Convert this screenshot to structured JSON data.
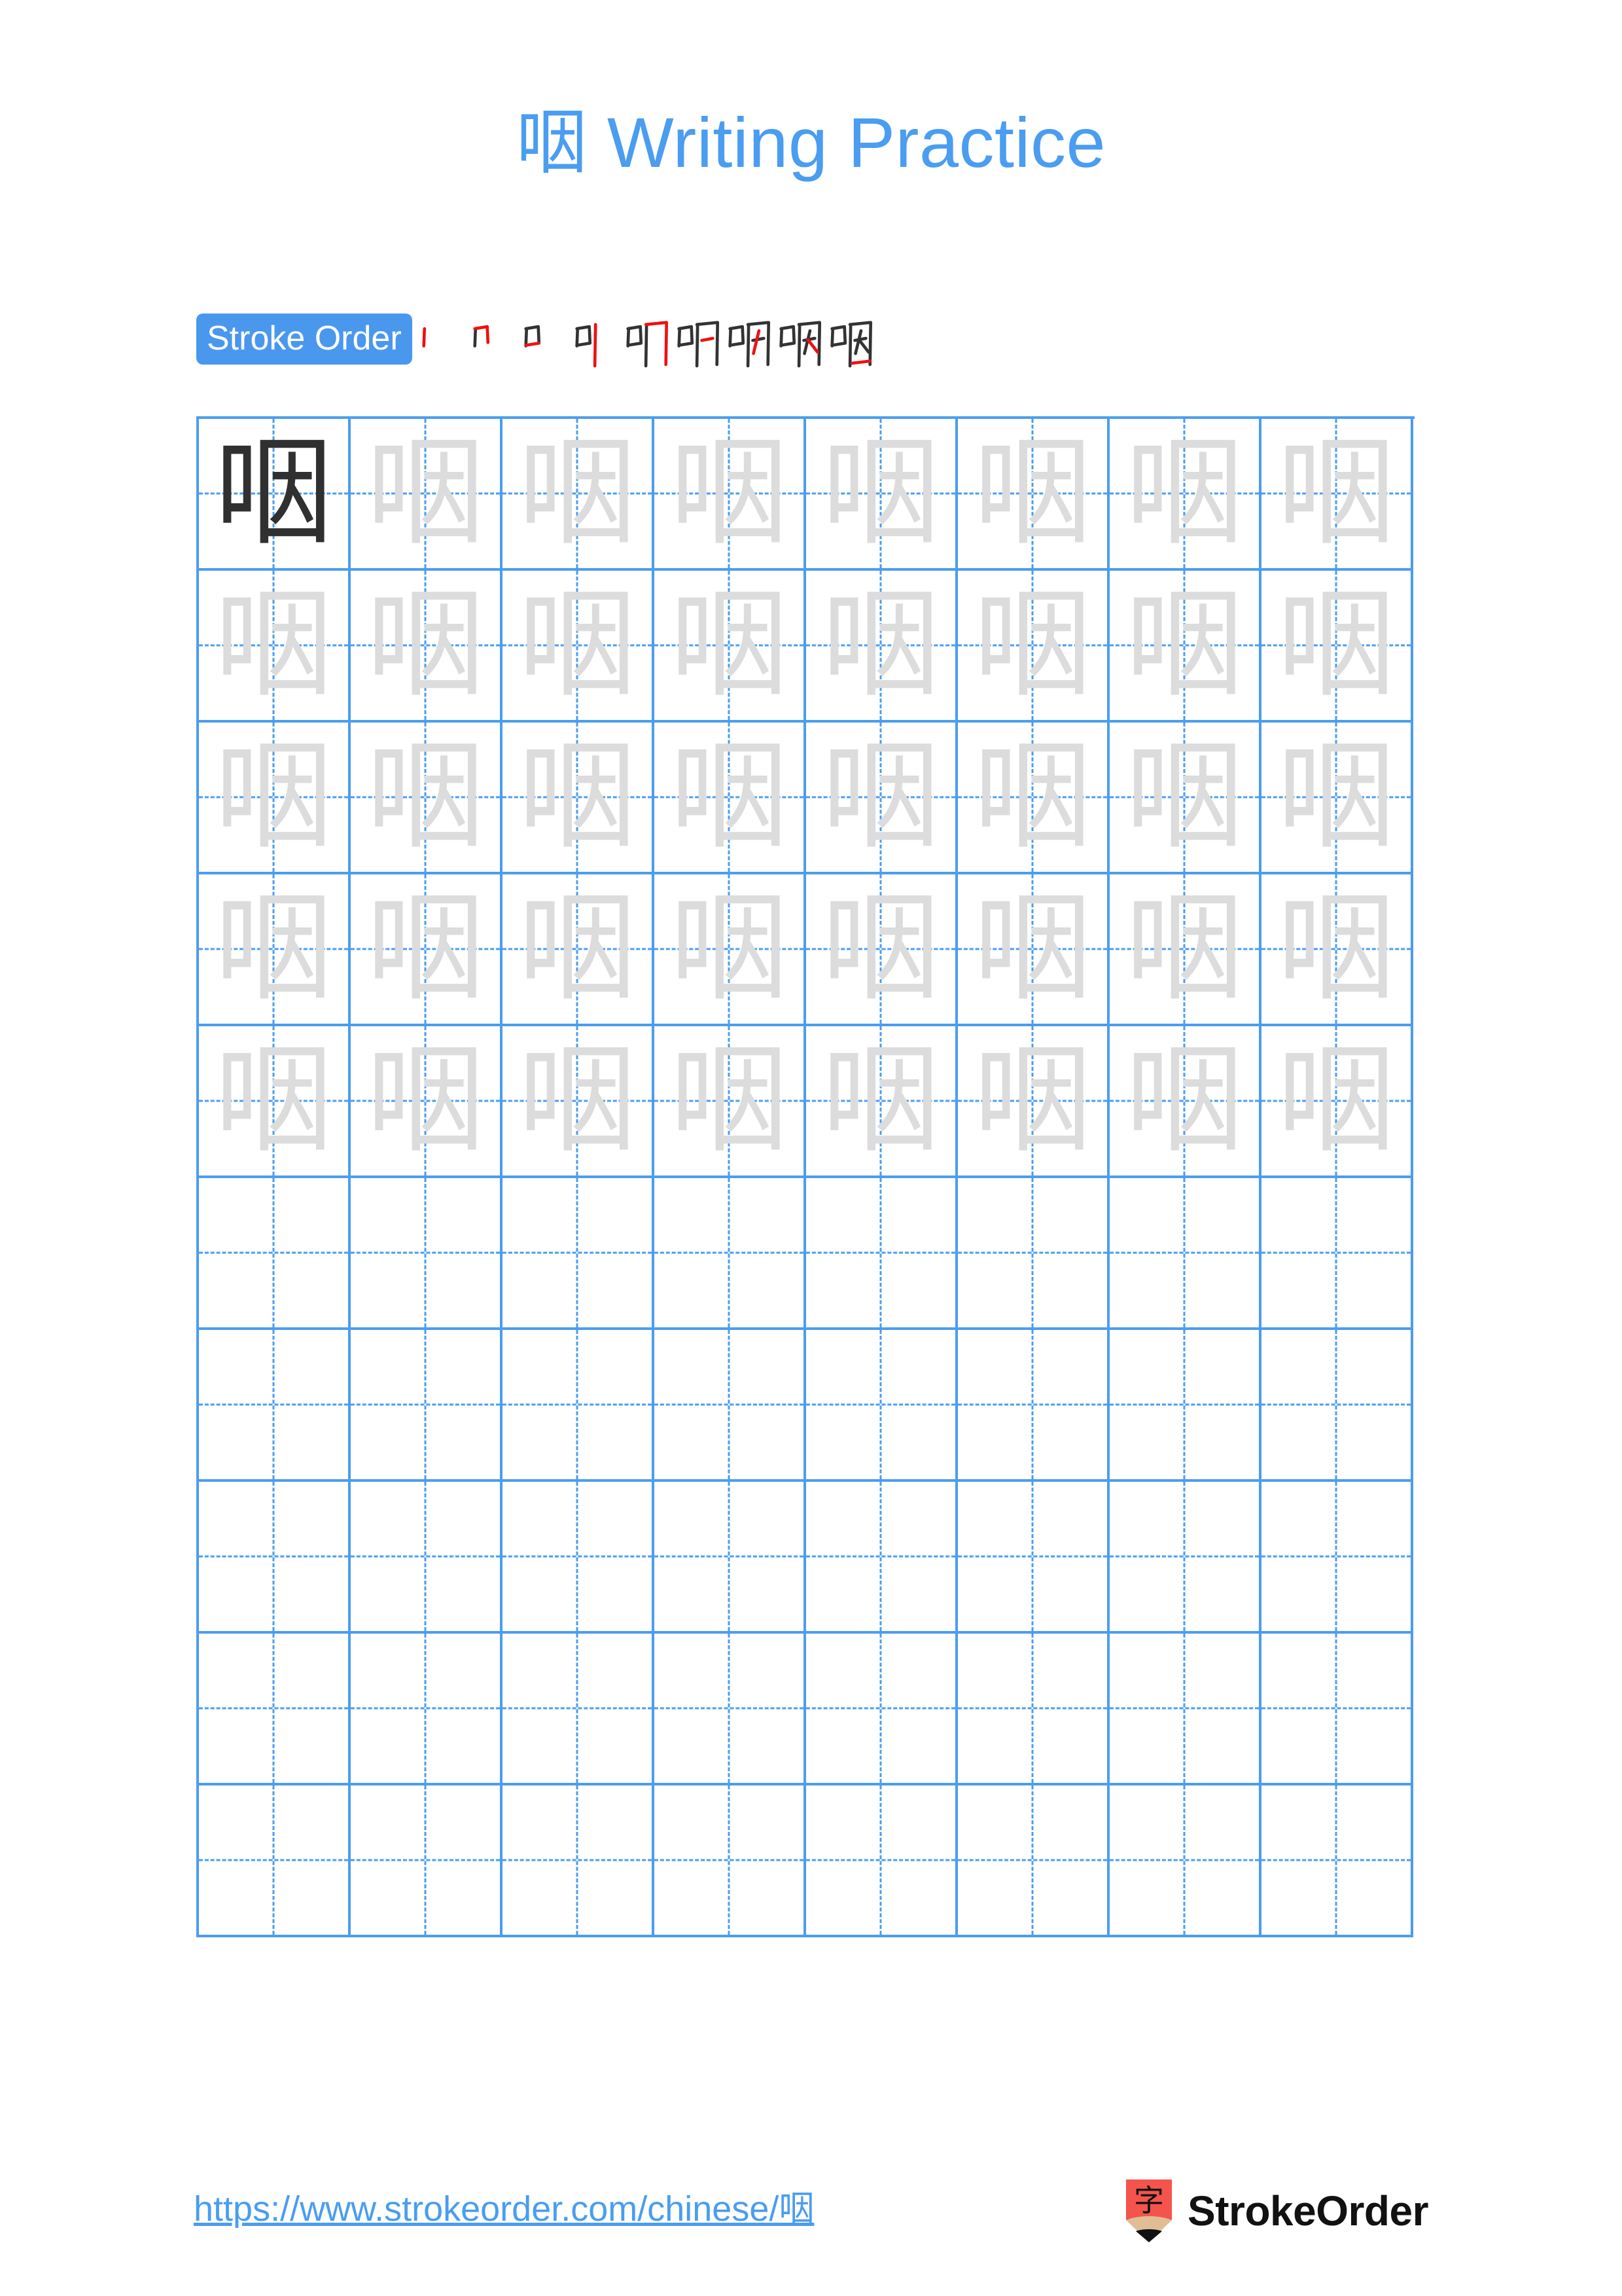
{
  "page": {
    "character": "咽",
    "title": "咽 Writing Practice",
    "title_suffix": "Writing Practice",
    "background_color": "#ffffff",
    "accent_color": "#4a9df0",
    "badge_color": "#4a97ee",
    "solid_char_color": "#303030",
    "trace_char_color": "#dcdcdc",
    "stroke_highlight_color": "#ee1111",
    "stroke_ink_color": "#333333"
  },
  "stroke_order": {
    "badge_label": "Stroke Order",
    "total_strokes": 9,
    "steps": [
      {
        "index": 1,
        "label": "丨",
        "cumulative": "丨"
      },
      {
        "index": 2,
        "label": "冂",
        "cumulative": "冂"
      },
      {
        "index": 3,
        "label": "口",
        "cumulative": "口"
      },
      {
        "index": 4,
        "label": "叫",
        "cumulative": "口丨"
      },
      {
        "index": 5,
        "label": "叮",
        "cumulative": "口冂"
      },
      {
        "index": 6,
        "label": "吖",
        "cumulative": "口冂一"
      },
      {
        "index": 7,
        "label": "呎",
        "cumulative": "口囗丿"
      },
      {
        "index": 8,
        "label": "咽",
        "cumulative": "口囗人"
      },
      {
        "index": 9,
        "label": "咽",
        "cumulative": "咽"
      }
    ]
  },
  "grid": {
    "columns": 8,
    "rows": 10,
    "traced_rows": 5,
    "empty_rows": 5,
    "solid_cell": {
      "row": 0,
      "col": 0
    },
    "cells": [
      [
        "咽",
        "咽",
        "咽",
        "咽",
        "咽",
        "咽",
        "咽",
        "咽"
      ],
      [
        "咽",
        "咽",
        "咽",
        "咽",
        "咽",
        "咽",
        "咽",
        "咽"
      ],
      [
        "咽",
        "咽",
        "咽",
        "咽",
        "咽",
        "咽",
        "咽",
        "咽"
      ],
      [
        "咽",
        "咽",
        "咽",
        "咽",
        "咽",
        "咽",
        "咽",
        "咽"
      ],
      [
        "咽",
        "咽",
        "咽",
        "咽",
        "咽",
        "咽",
        "咽",
        "咽"
      ],
      [
        "",
        "",
        "",
        "",
        "",
        "",
        "",
        ""
      ],
      [
        "",
        "",
        "",
        "",
        "",
        "",
        "",
        ""
      ],
      [
        "",
        "",
        "",
        "",
        "",
        "",
        "",
        ""
      ],
      [
        "",
        "",
        "",
        "",
        "",
        "",
        "",
        ""
      ],
      [
        "",
        "",
        "",
        "",
        "",
        "",
        "",
        ""
      ]
    ]
  },
  "footer": {
    "url": "https://www.strokeorder.com/chinese/咽",
    "brand_name": "StrokeOrder",
    "logo_char": "字",
    "logo_color": "#f4544c",
    "logo_tip_color": "#e0bd95"
  }
}
